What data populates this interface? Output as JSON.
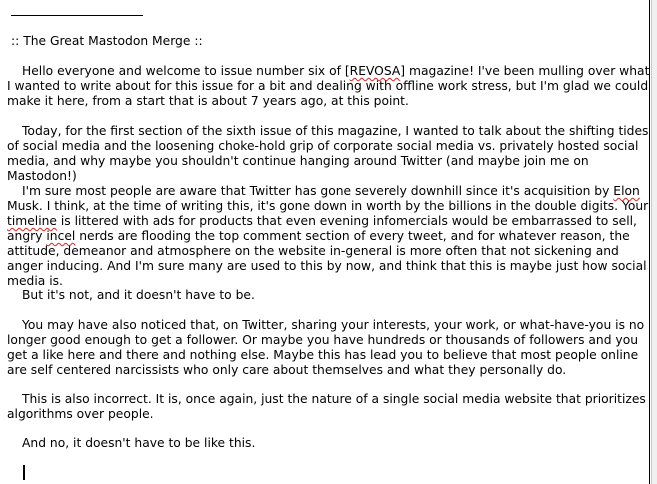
{
  "document": {
    "title": ":: The Great Mastodon Merge ::",
    "paragraphs": {
      "p1": {
        "a": "Hello everyone and welcome to issue number six of [",
        "b": "REVOSA",
        "c": "] magazine! I've been mulling over what I wanted to write about for this issue for a bit and dealing with offline work stress, but I'm glad we could make it here, from a start that is about 7 years ago, at this point."
      },
      "p2": "Today, for the first section of the sixth issue of this magazine, I wanted to talk about the shifting tides of social media and the loosening choke-hold grip of corporate social media vs. privately hosted social media, and why maybe you shouldn't continue hanging around Twitter (and maybe join me on Mastodon!)",
      "p3": {
        "a": "I'm sure most people are aware that Twitter has gone severely downhill since it's acquisition by ",
        "b": "Elon",
        "c": " Musk. I think, at the time of writing this, it's gone down in worth by the billions in the double digits. Your ",
        "d": "timeline",
        "e": " is littered with ads for products that even evening infomercials would be embarrassed to sell, angry ",
        "f": "incel",
        "g": " nerds are flooding the top comment section of every tweet, and for whatever reason, the attitude, demeanor and atmosphere on the website in-general is more often that not sickening and anger inducing. And I'm sure many are used to this by now, and think that this is maybe just how social media is."
      },
      "p4": "But it's not, and it doesn't have to be.",
      "p5": "You may have also noticed that, on Twitter, sharing your interests, your work, or what-have-you is no longer good enough to get a follower. Or maybe you have hundreds or thousands of followers and you get a like here and there and nothing else. Maybe this has lead you to believe that most people online are self centered narcissists who only care about themselves and what they personally do.",
      "p6": "This is also incorrect. It is, once again, just the nature of a single social media website that prioritizes algorithms over people.",
      "p7": "And no, it doesn't have to be like this."
    }
  },
  "colors": {
    "text": "#000000",
    "background": "#ffffff",
    "spellcheck_underline": "#d22222"
  }
}
